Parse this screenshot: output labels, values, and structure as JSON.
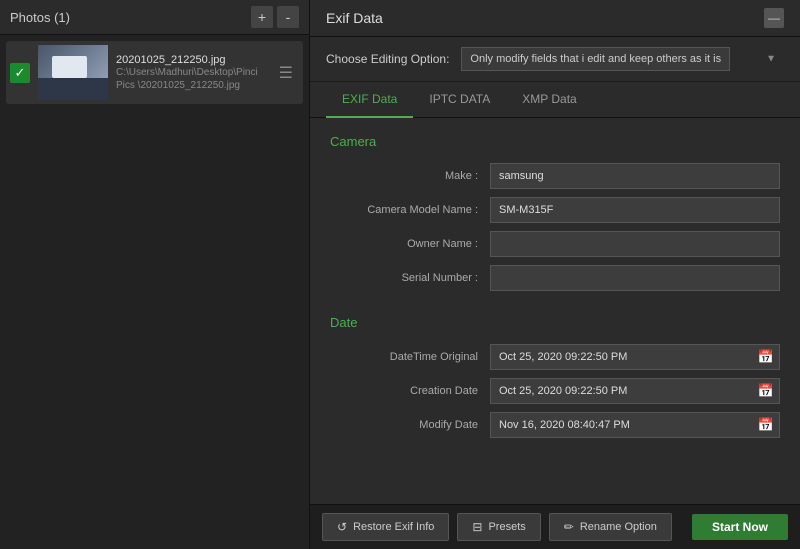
{
  "leftPanel": {
    "title": "Photos (1)",
    "addBtn": "+",
    "removeBtn": "-",
    "photo": {
      "name": "20201025_212250.jpg",
      "path": "C:\\Users\\Madhuri\\Desktop\\Pinci Pics\n\\20201025_212250.jpg"
    }
  },
  "rightPanel": {
    "title": "Exif Data",
    "editingOptions": {
      "label": "Choose Editing Option:",
      "value": "Only modify fields that i edit and keep others as it is"
    },
    "tabs": [
      {
        "label": "EXIF Data",
        "active": true
      },
      {
        "label": "IPTC DATA",
        "active": false
      },
      {
        "label": "XMP Data",
        "active": false
      }
    ],
    "cameraSection": {
      "title": "Camera",
      "fields": [
        {
          "label": "Make :",
          "value": "samsung",
          "id": "make"
        },
        {
          "label": "Camera Model Name :",
          "value": "SM-M315F",
          "id": "cameraModel"
        },
        {
          "label": "Owner Name :",
          "value": "",
          "id": "ownerName"
        },
        {
          "label": "Serial Number :",
          "value": "",
          "id": "serialNumber"
        }
      ]
    },
    "dateSection": {
      "title": "Date",
      "fields": [
        {
          "label": "DateTime Original",
          "value": "Oct 25, 2020 09:22:50 PM",
          "id": "dateTimeOriginal"
        },
        {
          "label": "Creation Date",
          "value": "Oct 25, 2020 09:22:50 PM",
          "id": "creationDate"
        },
        {
          "label": "Modify Date",
          "value": "Nov 16, 2020 08:40:47 PM",
          "id": "modifyDate"
        }
      ]
    }
  },
  "bottomToolbar": {
    "restoreBtn": "Restore Exif Info",
    "presetsBtn": "Presets",
    "renameBtn": "Rename Option",
    "startBtn": "Start Now"
  }
}
